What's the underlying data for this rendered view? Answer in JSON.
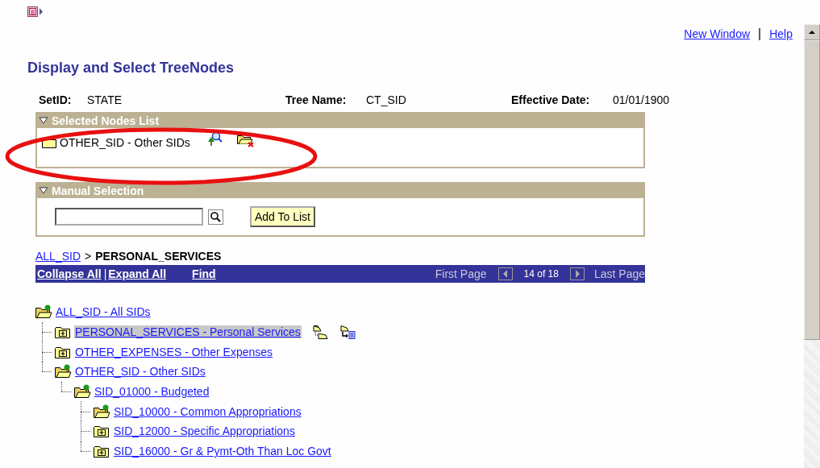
{
  "header": {
    "links": [
      {
        "label": "New Window"
      },
      {
        "label": "Help"
      }
    ],
    "separator": "|"
  },
  "title": "Display and Select TreeNodes",
  "fields": [
    {
      "label": "SetID:",
      "value": "STATE"
    },
    {
      "label": "Tree Name:",
      "value": "CT_SID"
    },
    {
      "label": "Effective Date:",
      "value": "01/01/1900"
    }
  ],
  "selected_nodes": {
    "title": "Selected Nodes List",
    "expanded": true,
    "items": [
      {
        "label": "OTHER_SID - Other SIDs"
      }
    ]
  },
  "manual_selection": {
    "title": "Manual Selection",
    "expanded": true,
    "button": "Add To List"
  },
  "breadcrumb": {
    "link": "ALL_SID",
    "separator": ">",
    "current": "PERSONAL_SERVICES"
  },
  "toolbar": {
    "links": [
      "Collapse All",
      "Expand All"
    ],
    "separator": "|",
    "find": "Find",
    "first": "First Page",
    "page": "14 of 18",
    "last": "Last Page"
  },
  "tree": [
    {
      "label": "ALL_SID - All SIDs",
      "expanded": true,
      "selected": false,
      "children": [
        {
          "label": "PERSONAL_SERVICES - Personal Services",
          "expanded": false,
          "selected": true
        },
        {
          "label": "OTHER_EXPENSES - Other Expenses",
          "expanded": false,
          "selected": false
        },
        {
          "label": "OTHER_SID - Other SIDs",
          "expanded": true,
          "selected": false,
          "children": [
            {
              "label": "SID_01000 - Budgeted",
              "expanded": true,
              "selected": false,
              "children": [
                {
                  "label": "SID_10000 - Common Appropriations",
                  "expanded": true,
                  "selected": false
                },
                {
                  "label": "SID_12000 - Specific Appropriations",
                  "expanded": false,
                  "selected": false
                },
                {
                  "label": "SID_16000 - Gr & Pymt-Oth Than Loc Govt",
                  "expanded": false,
                  "selected": false
                }
              ]
            }
          ]
        }
      ]
    }
  ]
}
